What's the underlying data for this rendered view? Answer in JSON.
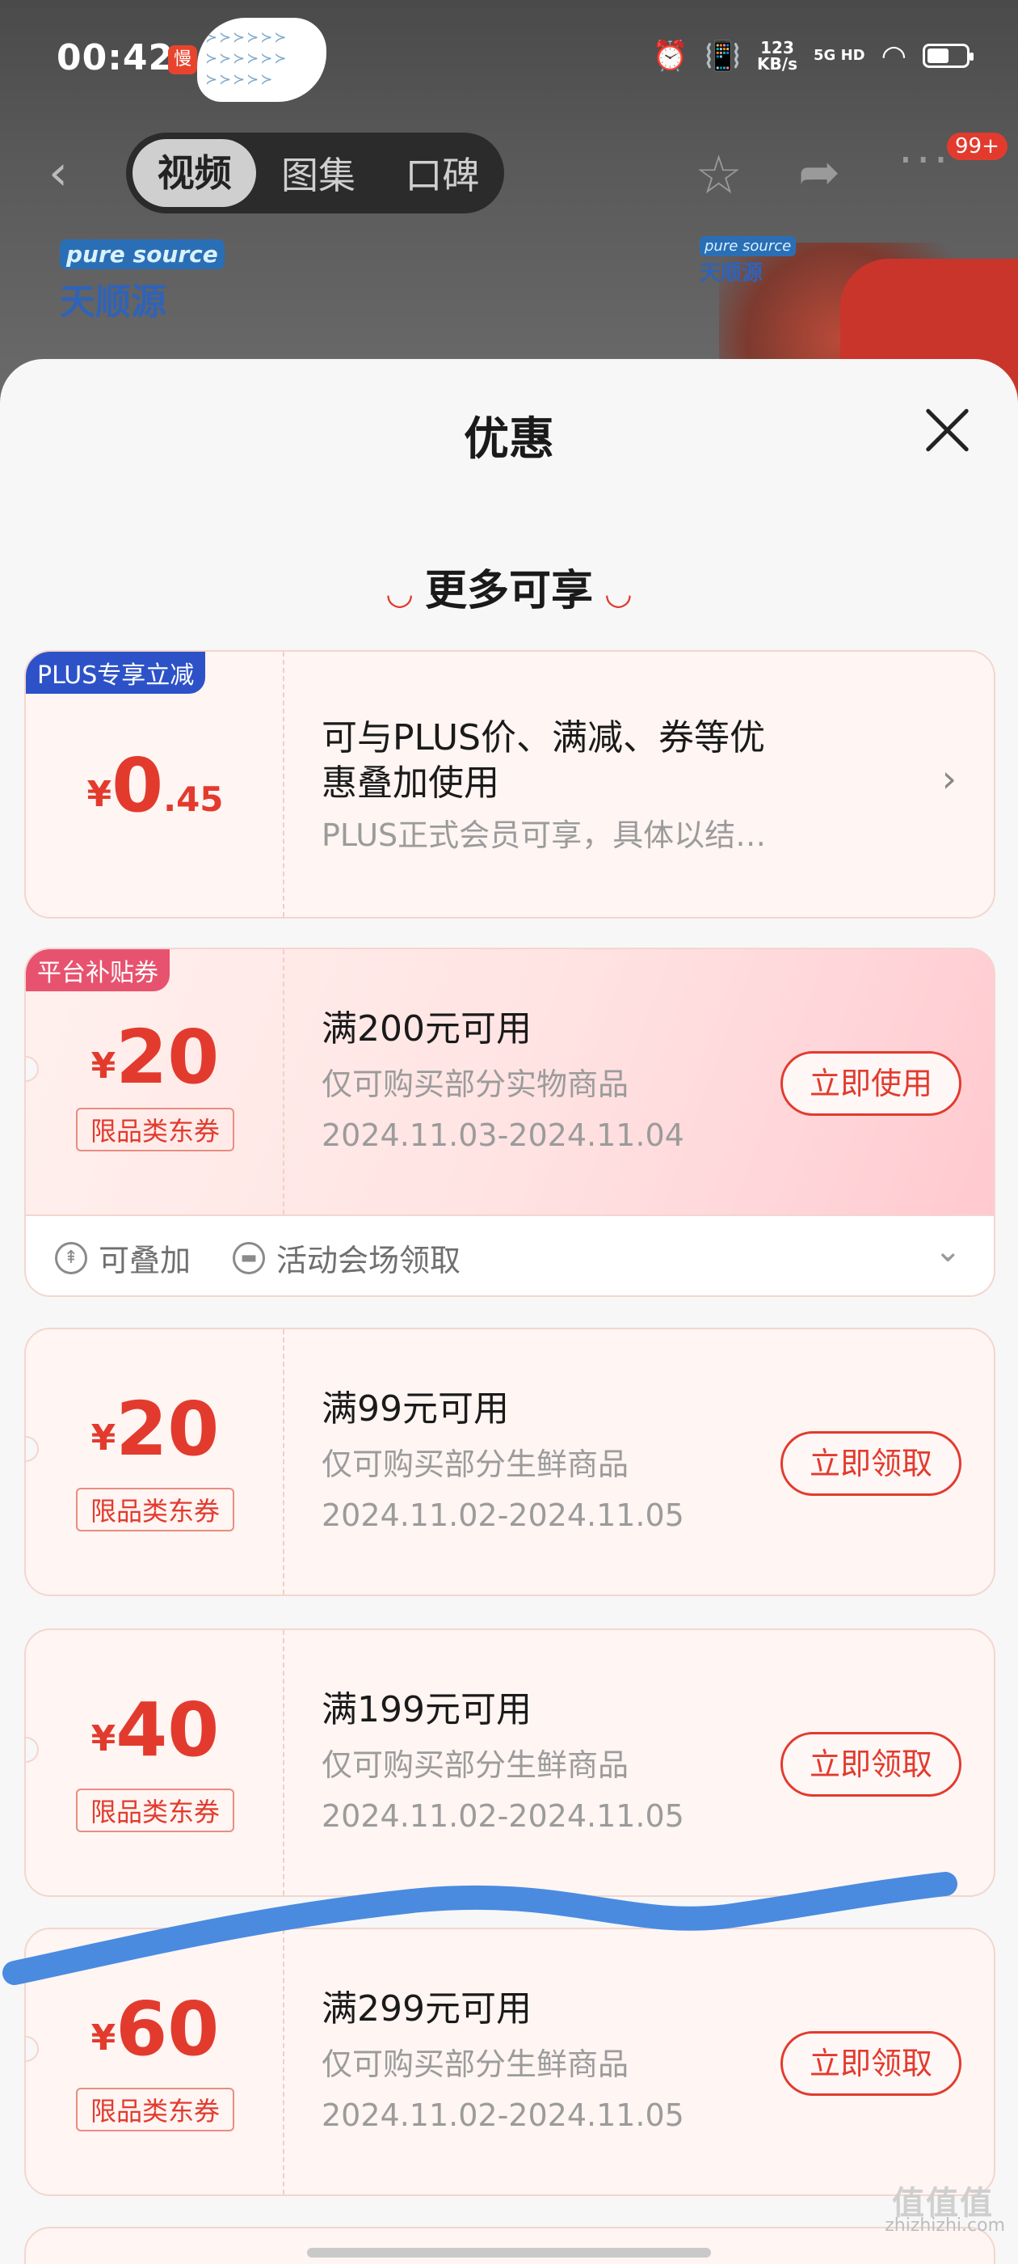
{
  "status_bar": {
    "time": "00:42",
    "app_badge": "慢",
    "net_speed_value": "123",
    "net_speed_unit": "KB/s",
    "network": "5G HD"
  },
  "nav": {
    "back": "‹",
    "tabs": [
      "视频",
      "图集",
      "口碑"
    ],
    "more_badge": "99+"
  },
  "background": {
    "brand_en": "pure source",
    "brand_cn": "天顺源"
  },
  "sheet": {
    "title": "优惠",
    "section_title": "更多可享"
  },
  "plus_card": {
    "tag": "PLUS专享立减",
    "currency": "¥",
    "amount_int": "0",
    "amount_dec": ".45",
    "title_line1": "可与PLUS价、满减、券等优",
    "title_line2": "惠叠加使用",
    "subtitle": "PLUS正式会员可享，具体以结…"
  },
  "coupons": [
    {
      "tag": "平台补贴券",
      "currency": "¥",
      "amount": "20",
      "kind": "限品类东券",
      "title": "满200元可用",
      "scope": "仅可购买部分实物商品",
      "period": "2024.11.03-2024.11.04",
      "action": "立即使用"
    },
    {
      "currency": "¥",
      "amount": "20",
      "kind": "限品类东券",
      "title": "满99元可用",
      "scope": "仅可购买部分生鲜商品",
      "period": "2024.11.02-2024.11.05",
      "action": "立即领取"
    },
    {
      "currency": "¥",
      "amount": "40",
      "kind": "限品类东券",
      "title": "满199元可用",
      "scope": "仅可购买部分生鲜商品",
      "period": "2024.11.02-2024.11.05",
      "action": "立即领取"
    },
    {
      "currency": "¥",
      "amount": "60",
      "kind": "限品类东券",
      "title": "满299元可用",
      "scope": "仅可购买部分生鲜商品",
      "period": "2024.11.02-2024.11.05",
      "action": "立即领取"
    }
  ],
  "promo_footer": {
    "stackable": "可叠加",
    "venue": "活动会场领取"
  },
  "watermark": {
    "logo": "值值值",
    "text": "zhizhizhi.com"
  },
  "colors": {
    "accent": "#e23b2e",
    "plus_tag": "#2d52c8",
    "subsidy_tag": "#e7536f",
    "scribble": "#4a8be0"
  }
}
